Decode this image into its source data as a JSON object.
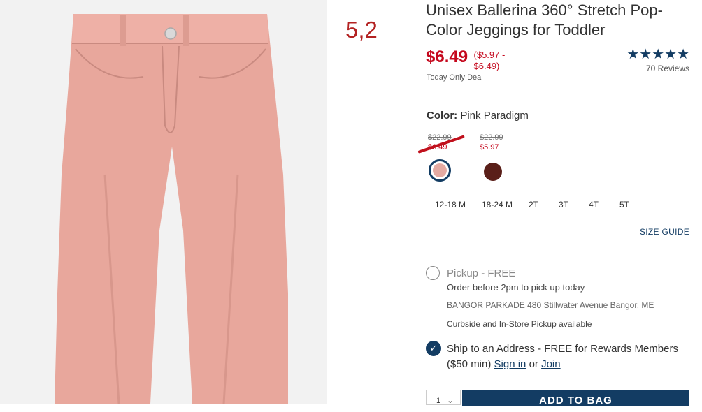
{
  "annotation": "5,2",
  "product": {
    "title": "Unisex Ballerina 360° Stretch Pop-Color Jeggings for Toddler",
    "price": "$6.49",
    "price_range_line1": "($5.97 -",
    "price_range_line2": "$6.49)",
    "deal": "Today Only Deal",
    "stars": "★★★★★",
    "reviews": "70 Reviews"
  },
  "color": {
    "label": "Color:",
    "value": "Pink Paradigm",
    "swatches": [
      {
        "old": "$22.99",
        "new": "$6.49",
        "color": "#e4aaa2"
      },
      {
        "old": "$22.99",
        "new": "$5.97",
        "color": "#5a1f19"
      }
    ]
  },
  "sizes": [
    "12-18 M",
    "18-24 M",
    "2T",
    "3T",
    "4T",
    "5T"
  ],
  "size_guide": "SIZE GUIDE",
  "pickup": {
    "title": "Pickup - FREE",
    "subtitle": "Order before 2pm to pick up today",
    "store": "BANGOR PARKADE 480 Stillwater Avenue  Bangor, ME",
    "curbside": "Curbside and In-Store Pickup available"
  },
  "ship": {
    "text": "Ship to an Address - FREE for Rewards Members ($50 min)",
    "sign_in": "Sign in",
    "or": "or",
    "join": "Join"
  },
  "qty": "1",
  "add_to_bag": "ADD TO BAG",
  "accent_color": "#133c63",
  "sale_color": "#c5081d",
  "product_color": "#e4aaa2"
}
